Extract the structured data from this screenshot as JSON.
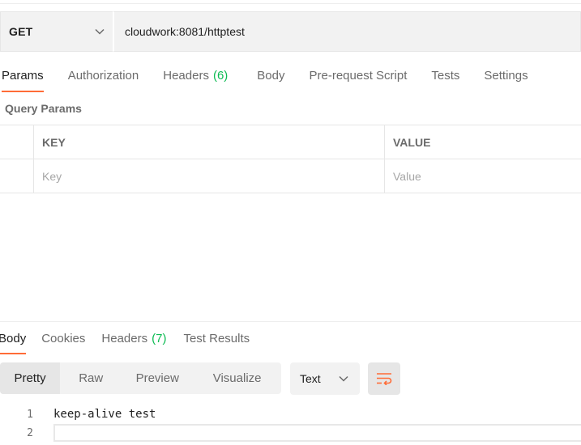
{
  "request": {
    "method": "GET",
    "url": "cloudwork:8081/httptest"
  },
  "request_tabs": [
    {
      "label": "Params",
      "count": ""
    },
    {
      "label": "Authorization",
      "count": ""
    },
    {
      "label": "Headers",
      "count": "(6)"
    },
    {
      "label": "Body",
      "count": ""
    },
    {
      "label": "Pre-request Script",
      "count": ""
    },
    {
      "label": "Tests",
      "count": ""
    },
    {
      "label": "Settings",
      "count": ""
    }
  ],
  "query_params": {
    "title": "Query Params",
    "headers": {
      "key": "KEY",
      "value": "VALUE"
    },
    "placeholders": {
      "key": "Key",
      "value": "Value"
    }
  },
  "response_tabs": [
    {
      "label": "Body",
      "count": ""
    },
    {
      "label": "Cookies",
      "count": ""
    },
    {
      "label": "Headers",
      "count": "(7)"
    },
    {
      "label": "Test Results",
      "count": ""
    }
  ],
  "response_toolbar": {
    "views": [
      "Pretty",
      "Raw",
      "Preview",
      "Visualize"
    ],
    "format": "Text"
  },
  "response_body": {
    "lines": [
      {
        "num": "1",
        "text": "keep-alive test"
      },
      {
        "num": "2",
        "text": ""
      }
    ]
  },
  "colors": {
    "accent": "#ff6c37",
    "count": "#0cbb52"
  },
  "icons": {
    "method_chevron": "chevron-down-icon",
    "format_chevron": "chevron-down-icon",
    "wrap": "wrap-lines-icon"
  }
}
